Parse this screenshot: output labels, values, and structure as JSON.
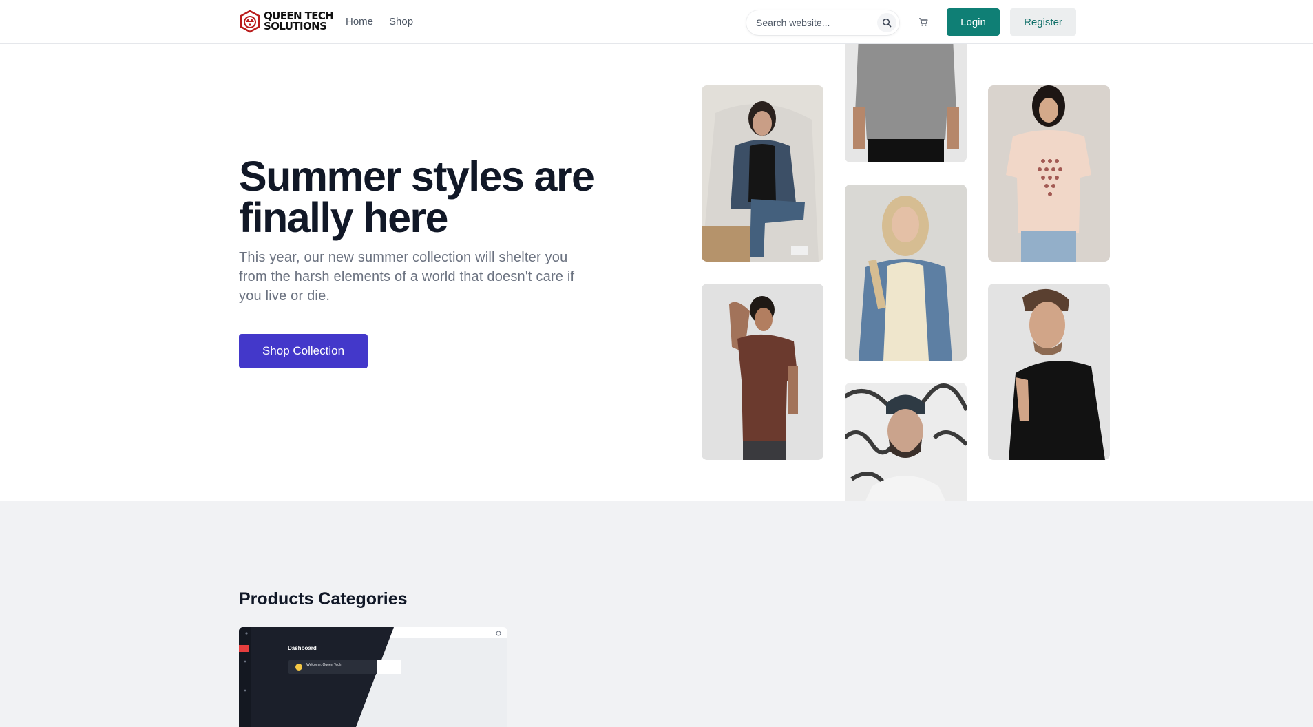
{
  "brand": {
    "line1": "QUEEN TECH",
    "line2": "SOLUTIONS",
    "logo_icon": "queen-crown-logo-icon",
    "logo_color": "#b91c1c"
  },
  "nav": {
    "home": "Home",
    "shop": "Shop"
  },
  "search": {
    "placeholder": "Search website...",
    "icon": "search-icon"
  },
  "cart": {
    "icon": "cart-icon"
  },
  "auth": {
    "login": "Login",
    "register": "Register",
    "login_color": "#0f7f75"
  },
  "hero": {
    "title": "Summer styles are finally here",
    "text": "This year, our new summer collection will shelter you from the harsh elements of a world that doesn't care if you live or die.",
    "cta": "Shop Collection",
    "cta_color": "#4338ca",
    "photos": [
      "woman in denim jacket seated",
      "man in brown t-shirt",
      "man in grey t-shirt",
      "woman in denim jacket with cream top",
      "bearded man in beanie",
      "woman in peach graphic t-shirt",
      "man in black t-shirt"
    ]
  },
  "categories": {
    "heading": "Products Categories",
    "card": {
      "dashboard_label": "Dashboard",
      "welcome_text": "Welcome, Queen Tech"
    }
  }
}
